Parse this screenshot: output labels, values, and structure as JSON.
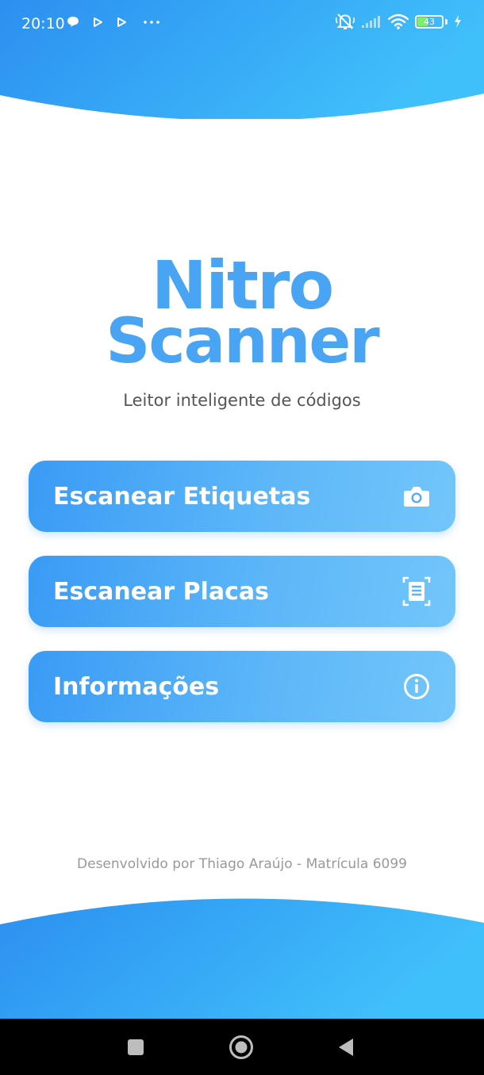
{
  "status_bar": {
    "time": "20:10",
    "battery_level": "43",
    "battery_fraction": 0.43,
    "icons": [
      "chat-bubble-icon",
      "play-icon",
      "play-icon",
      "more-dots-icon",
      "mute-icon",
      "signal-icon",
      "wifi-icon",
      "battery-icon",
      "charging-icon"
    ]
  },
  "app": {
    "logo_line1": "Nitro",
    "logo_line2": "Scanner",
    "subtitle": "Leitor inteligente de códigos"
  },
  "menu": [
    {
      "label": "Escanear Etiquetas",
      "icon": "camera-icon"
    },
    {
      "label": "Escanear Placas",
      "icon": "document-scan-icon"
    },
    {
      "label": "Informações",
      "icon": "info-icon"
    }
  ],
  "footer": {
    "credit": "Desenvolvido por Thiago Araújo - Matrícula 6099"
  },
  "nav_bar": {
    "items": [
      "recents-square-icon",
      "home-circle-icon",
      "back-triangle-icon"
    ]
  },
  "colors": {
    "accent": "#3a9bf5",
    "accent_light": "#72c6fa",
    "logo": "#4aa4f4"
  }
}
